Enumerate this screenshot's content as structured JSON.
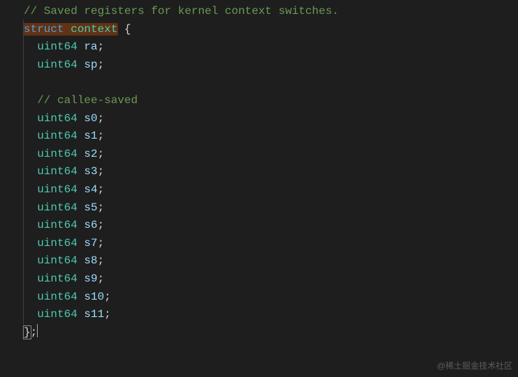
{
  "code": {
    "comment_top": "// Saved registers for kernel context switches.",
    "struct_keyword": "struct",
    "struct_name": "context",
    "brace_open": "{",
    "fields_top": [
      {
        "type": "uint64",
        "name": "ra"
      },
      {
        "type": "uint64",
        "name": "sp"
      }
    ],
    "comment_mid": "// callee-saved",
    "fields_saved": [
      {
        "type": "uint64",
        "name": "s0"
      },
      {
        "type": "uint64",
        "name": "s1"
      },
      {
        "type": "uint64",
        "name": "s2"
      },
      {
        "type": "uint64",
        "name": "s3"
      },
      {
        "type": "uint64",
        "name": "s4"
      },
      {
        "type": "uint64",
        "name": "s5"
      },
      {
        "type": "uint64",
        "name": "s6"
      },
      {
        "type": "uint64",
        "name": "s7"
      },
      {
        "type": "uint64",
        "name": "s8"
      },
      {
        "type": "uint64",
        "name": "s9"
      },
      {
        "type": "uint64",
        "name": "s10"
      },
      {
        "type": "uint64",
        "name": "s11"
      }
    ],
    "brace_close": "}",
    "semicolon": ";"
  },
  "watermark": "@稀土掘金技术社区"
}
